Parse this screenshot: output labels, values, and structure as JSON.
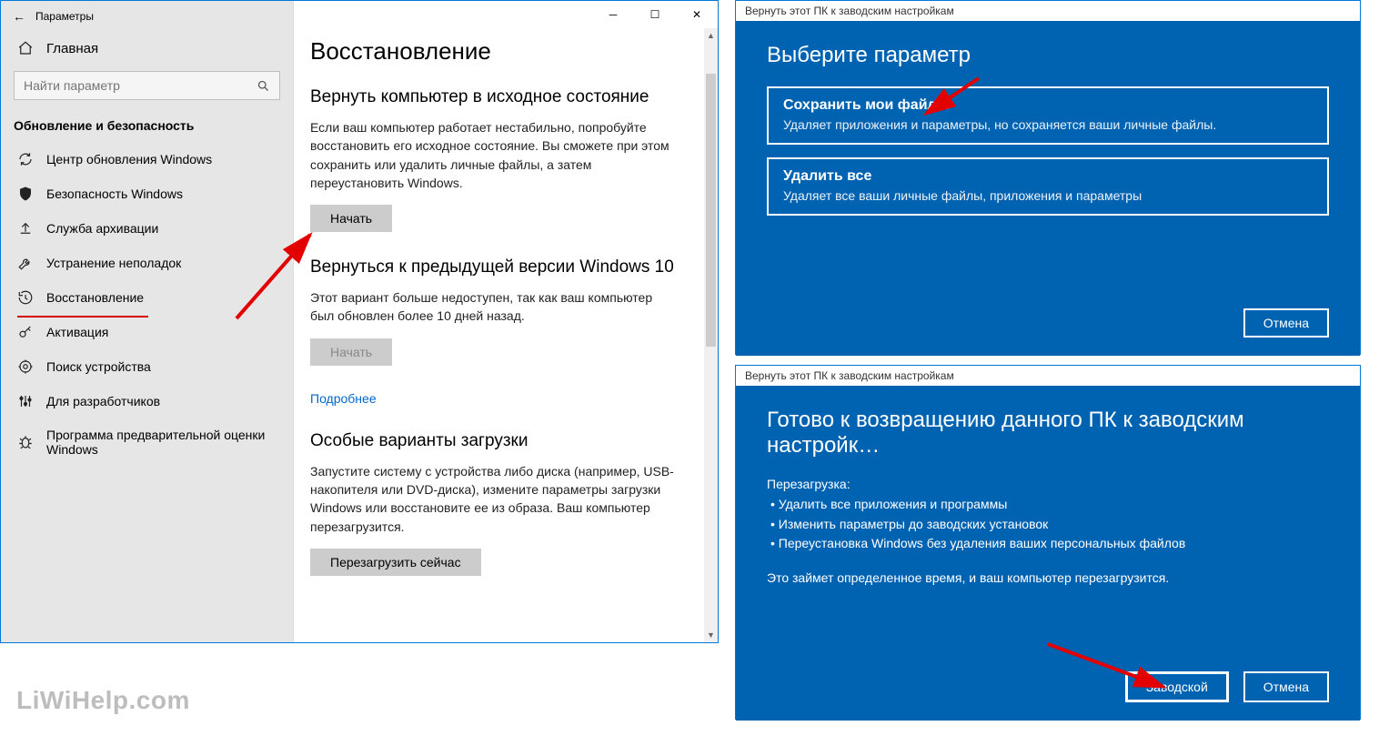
{
  "settings": {
    "window_title": "Параметры",
    "home_label": "Главная",
    "search_placeholder": "Найти параметр",
    "category": "Обновление и безопасность",
    "nav": [
      {
        "id": "update",
        "label": "Центр обновления Windows"
      },
      {
        "id": "security",
        "label": "Безопасность Windows"
      },
      {
        "id": "backup",
        "label": "Служба архивации"
      },
      {
        "id": "troubleshoot",
        "label": "Устранение неполадок"
      },
      {
        "id": "recovery",
        "label": "Восстановление"
      },
      {
        "id": "activation",
        "label": "Активация"
      },
      {
        "id": "find",
        "label": "Поиск устройства"
      },
      {
        "id": "dev",
        "label": "Для разработчиков"
      },
      {
        "id": "insider",
        "label": "Программа предварительной оценки Windows"
      }
    ],
    "content": {
      "page_title": "Восстановление",
      "reset": {
        "heading": "Вернуть компьютер в исходное состояние",
        "body": "Если ваш компьютер работает нестабильно, попробуйте восстановить его исходное состояние. Вы сможете при этом сохранить или удалить личные файлы, а затем переустановить Windows.",
        "button": "Начать"
      },
      "revert": {
        "heading": "Вернуться к предыдущей версии Windows 10",
        "body": "Этот вариант больше недоступен, так как ваш компьютер был обновлен более 10 дней назад.",
        "button": "Начать",
        "link": "Подробнее"
      },
      "advanced": {
        "heading": "Особые варианты загрузки",
        "body": "Запустите систему с устройства либо диска (например, USB-накопителя или DVD-диска), измените параметры загрузки Windows или восстановите ее из образа. Ваш компьютер перезагрузится.",
        "button": "Перезагрузить сейчас"
      }
    }
  },
  "dialog1": {
    "title": "Вернуть этот ПК к заводским настройкам",
    "heading": "Выберите параметр",
    "options": [
      {
        "title": "Сохранить мои файлы",
        "desc": "Удаляет приложения и параметры, но сохраняется ваши личные файлы."
      },
      {
        "title": "Удалить все",
        "desc": "Удаляет все ваши личные файлы, приложения и параметры"
      }
    ],
    "cancel": "Отмена"
  },
  "dialog2": {
    "title": "Вернуть этот ПК к заводским настройкам",
    "heading": "Готово к возвращению данного ПК к заводским настройк…",
    "subtitle": "Перезагрузка:",
    "bullets": [
      "Удалить все приложения и программы",
      "Изменить параметры до заводских установок",
      "Переустановка Windows без удаления ваших персональных файлов"
    ],
    "note": "Это займет определенное время, и ваш компьютер перезагрузится.",
    "primary": "Заводской",
    "cancel": "Отмена"
  },
  "watermark": "LiWiHelp.com"
}
